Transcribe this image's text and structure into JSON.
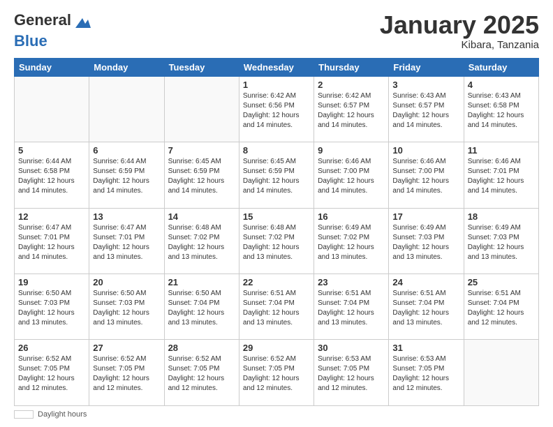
{
  "header": {
    "logo_line1": "General",
    "logo_line2": "Blue",
    "month_title": "January 2025",
    "location": "Kibara, Tanzania"
  },
  "footer": {
    "note": "Daylight hours"
  },
  "weekdays": [
    "Sunday",
    "Monday",
    "Tuesday",
    "Wednesday",
    "Thursday",
    "Friday",
    "Saturday"
  ],
  "weeks": [
    [
      {
        "day": "",
        "info": ""
      },
      {
        "day": "",
        "info": ""
      },
      {
        "day": "",
        "info": ""
      },
      {
        "day": "1",
        "info": "Sunrise: 6:42 AM\nSunset: 6:56 PM\nDaylight: 12 hours\nand 14 minutes."
      },
      {
        "day": "2",
        "info": "Sunrise: 6:42 AM\nSunset: 6:57 PM\nDaylight: 12 hours\nand 14 minutes."
      },
      {
        "day": "3",
        "info": "Sunrise: 6:43 AM\nSunset: 6:57 PM\nDaylight: 12 hours\nand 14 minutes."
      },
      {
        "day": "4",
        "info": "Sunrise: 6:43 AM\nSunset: 6:58 PM\nDaylight: 12 hours\nand 14 minutes."
      }
    ],
    [
      {
        "day": "5",
        "info": "Sunrise: 6:44 AM\nSunset: 6:58 PM\nDaylight: 12 hours\nand 14 minutes."
      },
      {
        "day": "6",
        "info": "Sunrise: 6:44 AM\nSunset: 6:59 PM\nDaylight: 12 hours\nand 14 minutes."
      },
      {
        "day": "7",
        "info": "Sunrise: 6:45 AM\nSunset: 6:59 PM\nDaylight: 12 hours\nand 14 minutes."
      },
      {
        "day": "8",
        "info": "Sunrise: 6:45 AM\nSunset: 6:59 PM\nDaylight: 12 hours\nand 14 minutes."
      },
      {
        "day": "9",
        "info": "Sunrise: 6:46 AM\nSunset: 7:00 PM\nDaylight: 12 hours\nand 14 minutes."
      },
      {
        "day": "10",
        "info": "Sunrise: 6:46 AM\nSunset: 7:00 PM\nDaylight: 12 hours\nand 14 minutes."
      },
      {
        "day": "11",
        "info": "Sunrise: 6:46 AM\nSunset: 7:01 PM\nDaylight: 12 hours\nand 14 minutes."
      }
    ],
    [
      {
        "day": "12",
        "info": "Sunrise: 6:47 AM\nSunset: 7:01 PM\nDaylight: 12 hours\nand 14 minutes."
      },
      {
        "day": "13",
        "info": "Sunrise: 6:47 AM\nSunset: 7:01 PM\nDaylight: 12 hours\nand 13 minutes."
      },
      {
        "day": "14",
        "info": "Sunrise: 6:48 AM\nSunset: 7:02 PM\nDaylight: 12 hours\nand 13 minutes."
      },
      {
        "day": "15",
        "info": "Sunrise: 6:48 AM\nSunset: 7:02 PM\nDaylight: 12 hours\nand 13 minutes."
      },
      {
        "day": "16",
        "info": "Sunrise: 6:49 AM\nSunset: 7:02 PM\nDaylight: 12 hours\nand 13 minutes."
      },
      {
        "day": "17",
        "info": "Sunrise: 6:49 AM\nSunset: 7:03 PM\nDaylight: 12 hours\nand 13 minutes."
      },
      {
        "day": "18",
        "info": "Sunrise: 6:49 AM\nSunset: 7:03 PM\nDaylight: 12 hours\nand 13 minutes."
      }
    ],
    [
      {
        "day": "19",
        "info": "Sunrise: 6:50 AM\nSunset: 7:03 PM\nDaylight: 12 hours\nand 13 minutes."
      },
      {
        "day": "20",
        "info": "Sunrise: 6:50 AM\nSunset: 7:03 PM\nDaylight: 12 hours\nand 13 minutes."
      },
      {
        "day": "21",
        "info": "Sunrise: 6:50 AM\nSunset: 7:04 PM\nDaylight: 12 hours\nand 13 minutes."
      },
      {
        "day": "22",
        "info": "Sunrise: 6:51 AM\nSunset: 7:04 PM\nDaylight: 12 hours\nand 13 minutes."
      },
      {
        "day": "23",
        "info": "Sunrise: 6:51 AM\nSunset: 7:04 PM\nDaylight: 12 hours\nand 13 minutes."
      },
      {
        "day": "24",
        "info": "Sunrise: 6:51 AM\nSunset: 7:04 PM\nDaylight: 12 hours\nand 13 minutes."
      },
      {
        "day": "25",
        "info": "Sunrise: 6:51 AM\nSunset: 7:04 PM\nDaylight: 12 hours\nand 12 minutes."
      }
    ],
    [
      {
        "day": "26",
        "info": "Sunrise: 6:52 AM\nSunset: 7:05 PM\nDaylight: 12 hours\nand 12 minutes."
      },
      {
        "day": "27",
        "info": "Sunrise: 6:52 AM\nSunset: 7:05 PM\nDaylight: 12 hours\nand 12 minutes."
      },
      {
        "day": "28",
        "info": "Sunrise: 6:52 AM\nSunset: 7:05 PM\nDaylight: 12 hours\nand 12 minutes."
      },
      {
        "day": "29",
        "info": "Sunrise: 6:52 AM\nSunset: 7:05 PM\nDaylight: 12 hours\nand 12 minutes."
      },
      {
        "day": "30",
        "info": "Sunrise: 6:53 AM\nSunset: 7:05 PM\nDaylight: 12 hours\nand 12 minutes."
      },
      {
        "day": "31",
        "info": "Sunrise: 6:53 AM\nSunset: 7:05 PM\nDaylight: 12 hours\nand 12 minutes."
      },
      {
        "day": "",
        "info": ""
      }
    ]
  ]
}
